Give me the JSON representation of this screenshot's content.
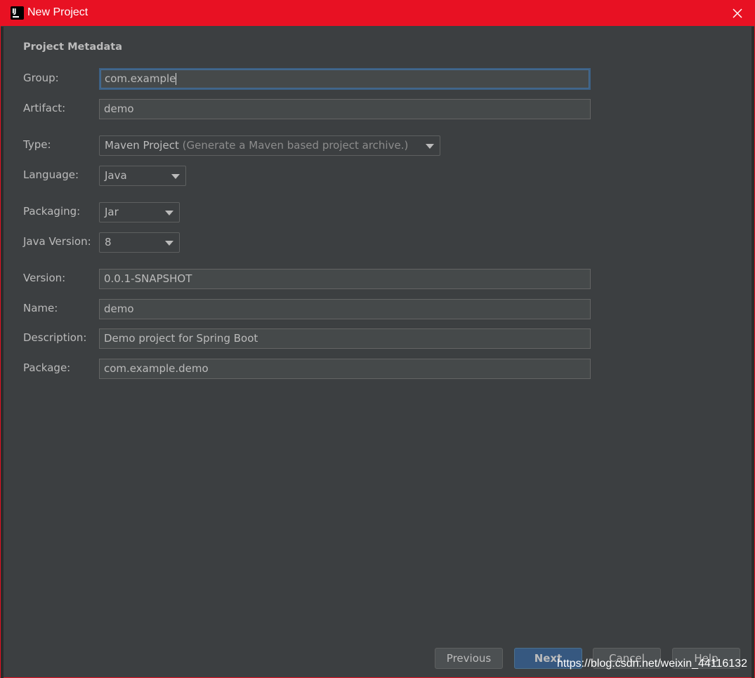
{
  "window": {
    "title": "New Project"
  },
  "section": {
    "title": "Project Metadata"
  },
  "form": {
    "group_label": "Group:",
    "group_value": "com.example",
    "artifact_label": "Artifact:",
    "artifact_value": "demo",
    "type_label": "Type:",
    "type_value": "Maven Project",
    "type_hint": "(Generate a Maven based project archive.)",
    "language_label": "Language:",
    "language_value": "Java",
    "packaging_label": "Packaging:",
    "packaging_value": "Jar",
    "java_version_label": "Java Version:",
    "java_version_value": "8",
    "version_label": "Version:",
    "version_value": "0.0.1-SNAPSHOT",
    "name_label": "Name:",
    "name_value": "demo",
    "description_label": "Description:",
    "description_value": "Demo project for Spring Boot",
    "package_label": "Package:",
    "package_value": "com.example.demo"
  },
  "buttons": {
    "previous": "Previous",
    "next": "Next",
    "cancel": "Cancel",
    "help": "Help"
  },
  "watermark": "https://blog.csdn.net/weixin_44116132",
  "icons": {
    "app": "intellij-idea-icon",
    "close": "close-icon",
    "dropdown": "chevron-down-icon"
  },
  "colors": {
    "titlebar": "#e81123",
    "background": "#3c3f41",
    "primary_button": "#365880",
    "focus_border": "#3d6185"
  }
}
